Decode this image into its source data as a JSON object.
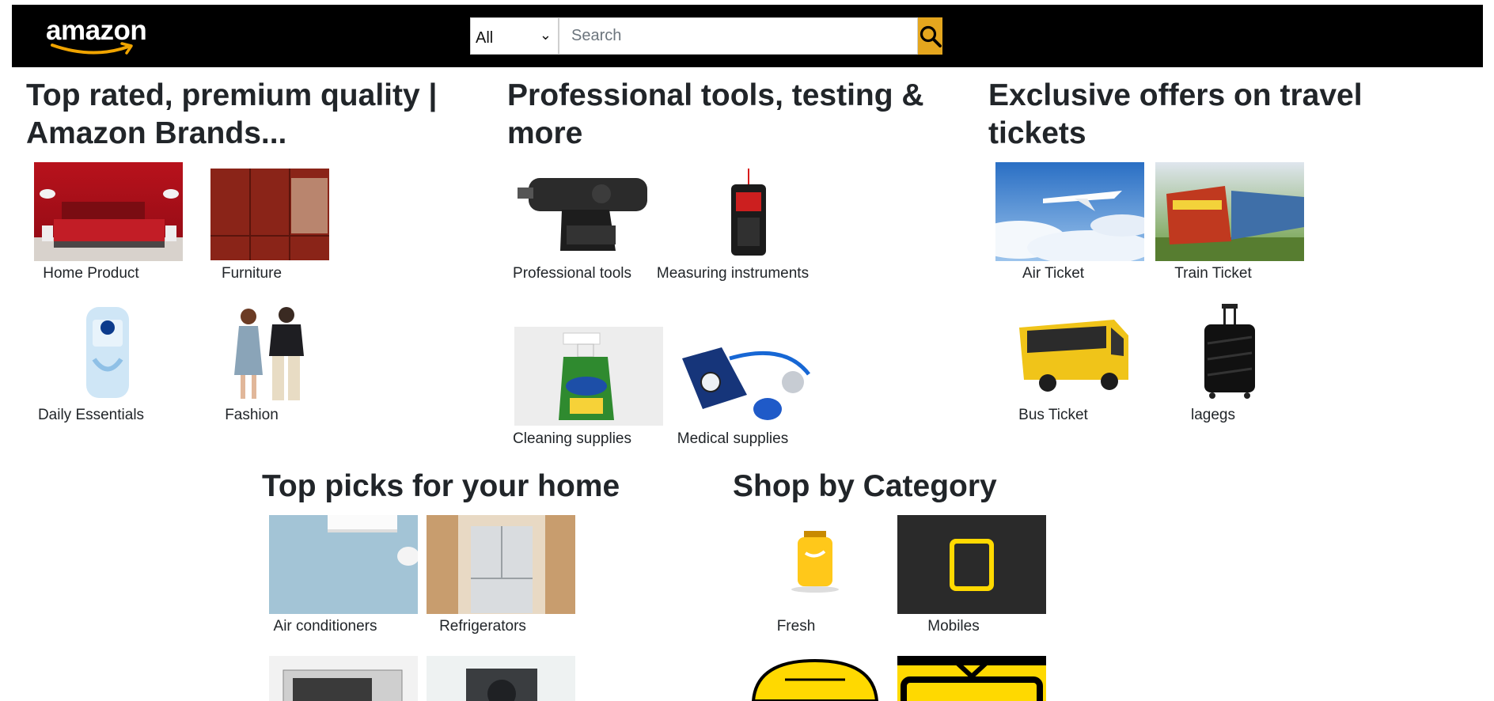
{
  "header": {
    "logo_text": "amazon",
    "category_select": {
      "value": "All"
    },
    "search": {
      "placeholder": "Search"
    }
  },
  "sections": {
    "brands": {
      "title_line1": "Top rated, premium quality |",
      "title_line2": "Amazon Brands...",
      "items": [
        "Home Product",
        "Furniture",
        "Daily Essentials",
        "Fashion"
      ]
    },
    "tools": {
      "title_line1": "Professional tools, testing &",
      "title_line2": "more",
      "items": [
        "Professional tools",
        "Measuring instruments",
        "Cleaning supplies",
        "Medical supplies"
      ]
    },
    "travel": {
      "title_line1": "Exclusive offers on travel",
      "title_line2": "tickets",
      "items": [
        "Air Ticket",
        "Train Ticket",
        "Bus Ticket",
        "lagegs"
      ]
    },
    "home": {
      "title": "Top picks for your home",
      "items": [
        "Air conditioners",
        "Refrigerators"
      ]
    },
    "category": {
      "title": "Shop by Category",
      "items": [
        "Fresh",
        "Mobiles"
      ]
    }
  },
  "colors": {
    "navbar": "#000000",
    "search_button": "#e4a61e",
    "accent_yellow": "#ffd900"
  }
}
